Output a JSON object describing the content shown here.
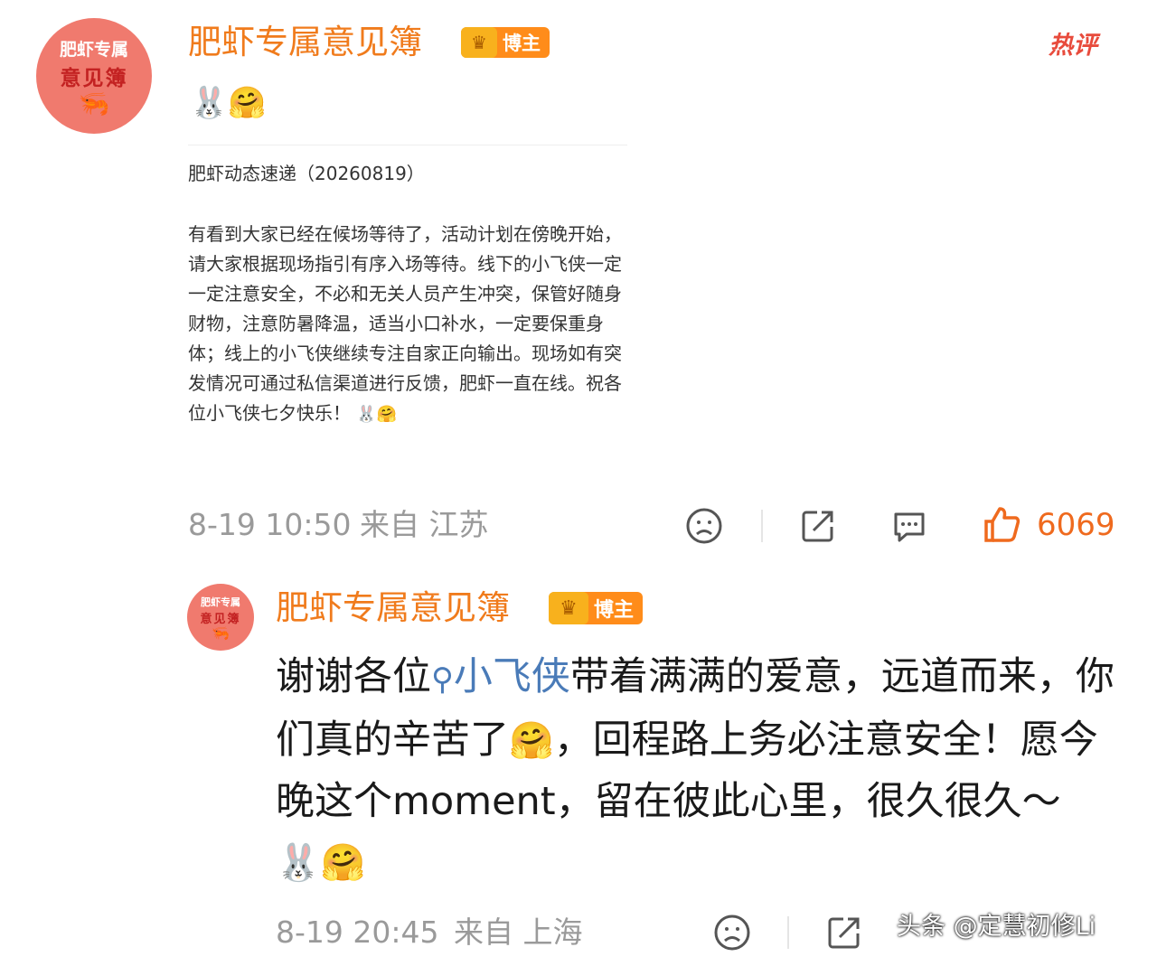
{
  "post": {
    "author": "肥虾专属意见簿",
    "avatar_line1": "肥虾专属",
    "avatar_line2": "意见簿",
    "badge": "博主",
    "hot_label": "热评",
    "card_title": "肥虾动态速递（20260819）",
    "card_body": "有看到大家已经在候场等待了，活动计划在傍晚开始，请大家根据现场指引有序入场等待。线下的小飞侠一定一定注意安全，不必和无关人员产生冲突，保管好随身财物，注意防暑降温，适当小口补水，一定要保重身体；线上的小飞侠继续专注自家正向输出。现场如有突发情况可通过私信渠道进行反馈，肥虾一直在线。祝各位小飞侠七夕快乐！",
    "time": "8-19 10:50",
    "source": "来自 江苏",
    "like_count": "6069"
  },
  "reply": {
    "author": "肥虾专属意见簿",
    "badge": "博主",
    "text_part1": "谢谢各位",
    "topic": "小飞侠",
    "text_part2": "带着满满的爱意，远道而来，你们真的辛苦了",
    "text_part3": "，回程路上务必注意安全！愿今晚这个moment，留在彼此心里，很久很久～",
    "time": "8-19 20:45",
    "source": "来自 上海"
  },
  "watermark": "头条 @定慧初修Li",
  "colors": {
    "name": "#f07b1c",
    "badge": "#ff8c1a",
    "like": "#ef6a1e",
    "link": "#4a7bb8",
    "meta": "#9a9a9a"
  }
}
